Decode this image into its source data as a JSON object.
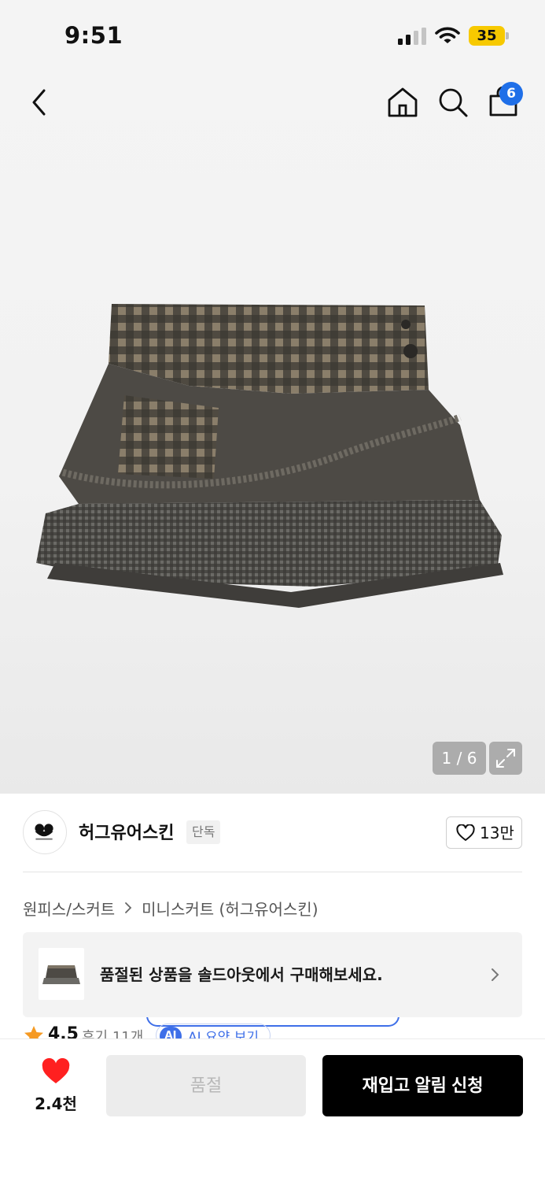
{
  "status_bar": {
    "time": "9:51",
    "battery": "35"
  },
  "nav": {
    "cart_count": "6"
  },
  "gallery": {
    "pager": "1 / 6"
  },
  "brand": {
    "name": "허그유어스킨",
    "tag": "단독",
    "likes": "13만"
  },
  "breadcrumb": {
    "category": "원피스/스커트",
    "subcategory": "미니스커트 (허그유어스킨)"
  },
  "banner": {
    "text": "품절된 상품을 솔드아웃에서 구매해보세요."
  },
  "rating": {
    "score": "4.5",
    "reviews": "후기 11개",
    "ai_badge": "AI",
    "ai_label": "AI 요약 보기"
  },
  "bottom_bar": {
    "wish_count": "2.4천",
    "soldout_label": "품절",
    "restock_label": "재입고 알림 신청"
  },
  "colors": {
    "accent_blue": "#1f6fe8",
    "heart_red": "#ff2020",
    "battery_yellow": "#f7c900",
    "primary_black": "#000000"
  }
}
